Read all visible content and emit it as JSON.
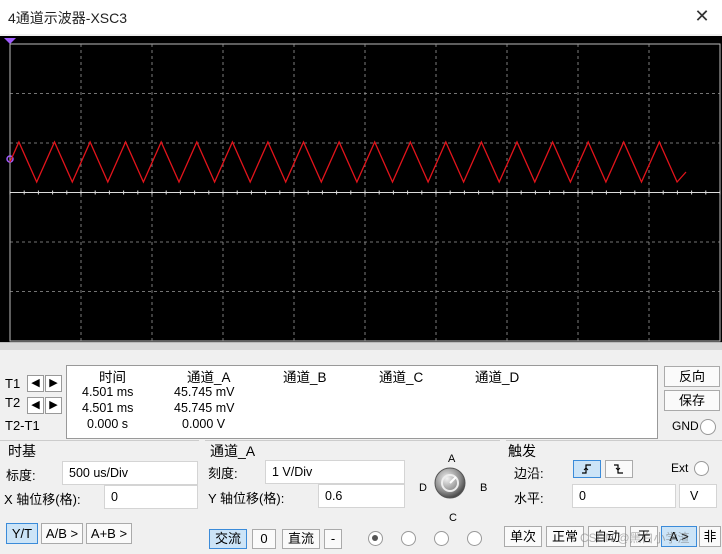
{
  "window": {
    "title": "4通道示波器-XSC3",
    "close_glyph": "✕"
  },
  "trace": {
    "color": "#e2141b",
    "cycles": 19
  },
  "cursor_table": {
    "headers": [
      "时间",
      "通道_A",
      "通道_B",
      "通道_C",
      "通道_D"
    ],
    "rows": [
      {
        "label": "T1",
        "time": "4.501 ms",
        "ch_a": "45.745 mV"
      },
      {
        "label": "T2",
        "time": "4.501 ms",
        "ch_a": "45.745 mV"
      },
      {
        "label": "T2-T1",
        "time": "0.000 s",
        "ch_a": "0.000 V"
      }
    ]
  },
  "side_buttons": {
    "reverse": "反向",
    "save": "保存",
    "gnd": "GND"
  },
  "timebase": {
    "title": "时基",
    "scale_label": "标度:",
    "scale_value": "500 us/Div",
    "xpos_label": "X 轴位移(格):",
    "xpos_value": "0",
    "modes": [
      "Y/T",
      "A/B >",
      "A+B >"
    ]
  },
  "channel": {
    "title": "通道_A",
    "scale_label": "刻度:",
    "scale_value": "1  V/Div",
    "ypos_label": "Y 轴位移(格):",
    "ypos_value": "0.6",
    "knob_labels": {
      "a": "A",
      "b": "B",
      "c": "C",
      "d": "D"
    },
    "coupling": [
      "交流",
      "0",
      "直流",
      "-"
    ]
  },
  "trigger": {
    "title": "触发",
    "edge_label": "边沿:",
    "ext_label": "Ext",
    "level_label": "水平:",
    "level_value": "0",
    "level_unit": "V",
    "modes": [
      "单次",
      "正常",
      "自动",
      "无",
      "A >",
      "非"
    ]
  },
  "watermark": "CSDN @黑白小学渣"
}
